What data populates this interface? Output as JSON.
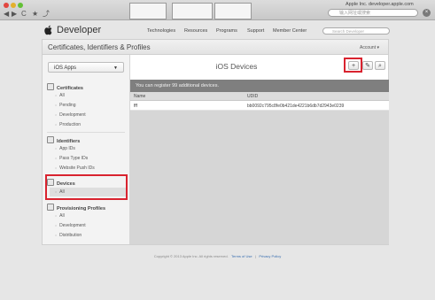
{
  "browser": {
    "back_label": "◀",
    "forward_label": "▶",
    "reload_label": "C",
    "bookmark_label": "★",
    "share_label": "⤴",
    "page_title": "Apple Inc. developer.apple.com",
    "search_placeholder": "输入网址或搜索",
    "close_label": "×"
  },
  "header": {
    "logo": "",
    "brand": "Developer",
    "nav": [
      "Technologies",
      "Resources",
      "Programs",
      "Support",
      "Member Center"
    ],
    "search_placeholder": "Search Developer"
  },
  "titlebar": {
    "title": "Certificates, Identifiers & Profiles",
    "account_label": "Account ▾"
  },
  "sidebar": {
    "dropdown_value": "iOS Apps",
    "sections": [
      {
        "label": "Certificates",
        "items": [
          "All",
          "Pending",
          "Development",
          "Production"
        ]
      },
      {
        "label": "Identifiers",
        "items": [
          "App IDs",
          "Pass Type IDs",
          "Website Push IDs"
        ]
      },
      {
        "label": "Devices",
        "items": [
          "All"
        ]
      },
      {
        "label": "Provisioning Profiles",
        "items": [
          "All",
          "Development",
          "Distribution"
        ]
      }
    ]
  },
  "content": {
    "title": "iOS Devices",
    "add_label": "+",
    "edit_label": "✎",
    "search_label": "⌕",
    "banner": "You can register 99 additional devices.",
    "columns": [
      "Name",
      "UDID"
    ],
    "rows": [
      [
        "fff",
        "bb0092c795c8fe0b421de4221b6db7d2943e0239"
      ]
    ]
  },
  "footer": {
    "copyright": "Copyright © 2013 Apple Inc. All rights reserved.",
    "terms": "Terms of Use",
    "separator": "|",
    "privacy": "Privacy Policy"
  },
  "colors": {
    "highlight": "#d9232f",
    "banner": "#7f7f7f",
    "link": "#3a6fb0"
  }
}
